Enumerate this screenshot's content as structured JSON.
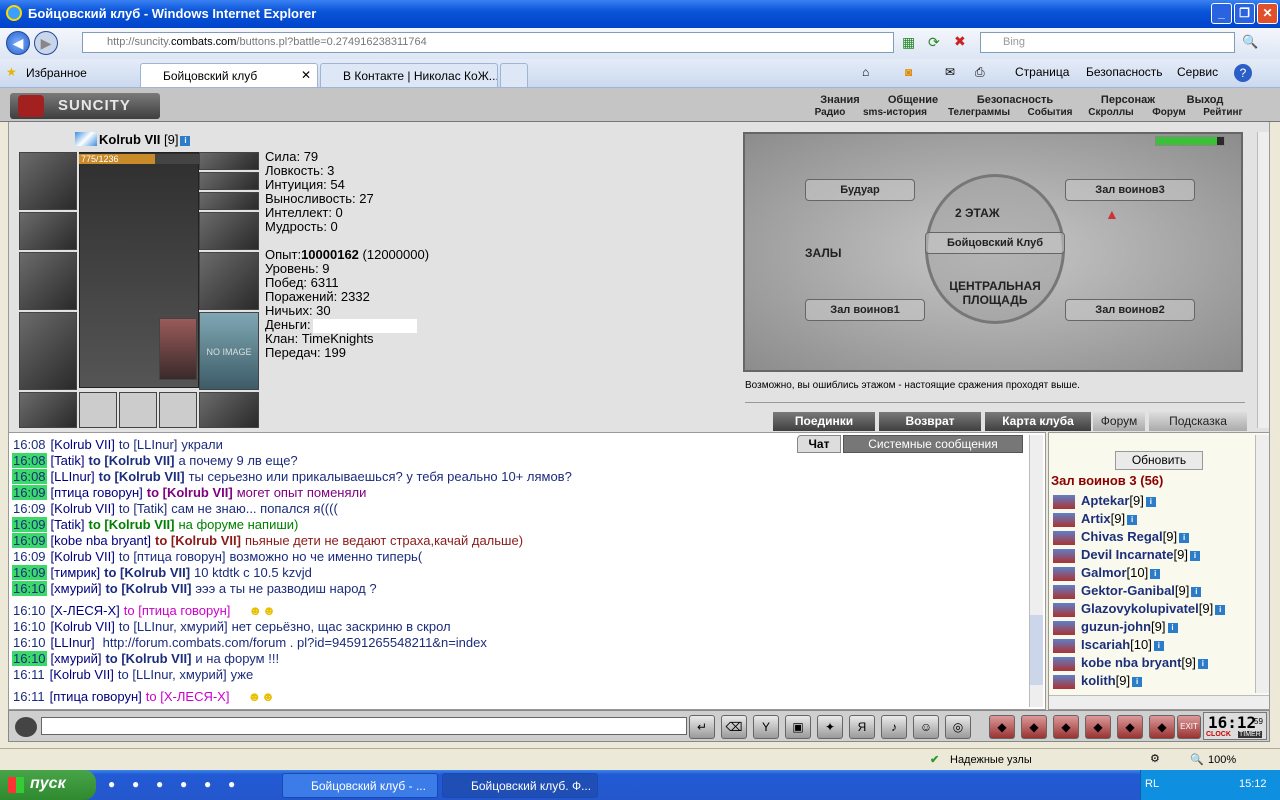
{
  "window": {
    "title": "Бойцовский клуб - Windows Internet Explorer"
  },
  "address": {
    "url_prefix": "http://suncity.",
    "url_domain": "combats.com",
    "url_path": "/buttons.pl?battle=0.274916238311764",
    "search_placeholder": "Bing"
  },
  "tabs": {
    "favorites": "Избранное",
    "tab1": "Бойцовский клуб",
    "tab2": "В Контакте | Николас КоЖ..."
  },
  "commands": {
    "page": "Страница",
    "safety": "Безопасность",
    "service": "Сервис"
  },
  "game_menu": {
    "top": [
      "Знания",
      "Общение",
      "Безопасность",
      "Персонаж",
      "Выход"
    ],
    "sub": [
      "Радио",
      "sms-история",
      "Телеграммы",
      "События",
      "Скроллы",
      "Форум",
      "Рейтинг"
    ],
    "logo": "SUNCITY"
  },
  "character": {
    "name": "Kolrub VII",
    "level": "[9]",
    "hp": "775/1236",
    "noimage": "NO IMAGE",
    "stats": [
      "Сила: 79",
      "Ловкость: 3",
      "Интуиция: 54",
      "Выносливость: 27",
      "Интеллект: 0",
      "Мудрость: 0"
    ],
    "exp_label": "Опыт:",
    "exp_value": "10000162",
    "exp_next": "(12000000)",
    "info": [
      "Уровень: 9",
      "Побед: 6311",
      "Поражений: 2332",
      "Ничьих: 30"
    ],
    "money_label": "Деньги:",
    "clan": "Клан: TimeKnights",
    "transfers": "Передач: 199"
  },
  "map": {
    "boudoir": "Будуар",
    "hall3": "Зал воинов3",
    "floor": "2 ЭТАЖ",
    "club": "Бойцовский Клуб",
    "halls": "ЗАЛЫ",
    "central": "ЦЕНТРАЛЬНАЯ ПЛОЩАДЬ",
    "hall1": "Зал воинов1",
    "hall2": "Зал воинов2",
    "note": "Возможно, вы ошиблись этажом - настоящие сражения проходят выше."
  },
  "panel_buttons": [
    "Поединки",
    "Возврат",
    "Карта клуба",
    "Форум",
    "Подсказка"
  ],
  "chat_tabs": {
    "chat": "Чат",
    "system": "Системные сообщения"
  },
  "chat": [
    {
      "time": "16:08",
      "hl": false,
      "from": "[Kolrub VII]",
      "to": "to [LLInur]",
      "msg": "украли",
      "color": "#1c2c7c"
    },
    {
      "time": "16:08",
      "hl": true,
      "from": "[Tatik]",
      "to": "to [Kolrub VII]",
      "msg": "а почему 9 лв еще?",
      "color": "#1c2c7c"
    },
    {
      "time": "16:08",
      "hl": true,
      "from": "[LLInur]",
      "to": "to [Kolrub VII]",
      "msg": "ты серьезно или прикалываешься? у тебя реально 10+ лямов?",
      "color": "#1c2c7c"
    },
    {
      "time": "16:09",
      "hl": true,
      "from": "[птица говорун]",
      "to": "to [Kolrub VII]",
      "msg": "могет опыт поменяли",
      "color": "#800080"
    },
    {
      "time": "16:09",
      "hl": false,
      "from": "[Kolrub VII]",
      "to": "to [Tatik]",
      "msg": "сам не знаю... попался я((((",
      "color": "#1c2c7c"
    },
    {
      "time": "16:09",
      "hl": true,
      "from": "[Tatik]",
      "to": "to [Kolrub VII]",
      "msg": "на форуме напиши)",
      "color": "#008000"
    },
    {
      "time": "16:09",
      "hl": true,
      "from": "[kobe nba bryant]",
      "to": "to [Kolrub VII]",
      "msg": "пьяные дети не ведают страха,качай дальше)",
      "color": "#8b1a1a"
    },
    {
      "time": "16:09",
      "hl": false,
      "from": "[Kolrub VII]",
      "to": "to [птица говорун]",
      "msg": "возможно но че именно типерь(",
      "color": "#1c2c7c"
    },
    {
      "time": "16:09",
      "hl": true,
      "from": "[тимрик]",
      "to": "to [Kolrub VII]",
      "msg": "10 ktdtk c 10.5 kzvjd",
      "color": "#1c2c7c"
    },
    {
      "time": "16:10",
      "hl": true,
      "from": "[хмурий]",
      "to": "to [Kolrub VII]",
      "msg": "эээ а ты не разводиш народ ?",
      "color": "#1c2c7c"
    },
    {
      "time": "16:10",
      "hl": false,
      "from": "[X-ЛЕСЯ-X]",
      "to": "to [птица говорун]",
      "msg": "",
      "color": "#cc00cc"
    },
    {
      "time": "16:10",
      "hl": false,
      "from": "[Kolrub VII]",
      "to": "to [LLInur, хмурий]",
      "msg": "нет серьёзно, щас заскриню в скрол",
      "color": "#1c2c7c"
    },
    {
      "time": "16:10",
      "hl": false,
      "from": "[LLInur]",
      "to": "",
      "msg": "http://forum.combats.com/forum . pl?id=94591265548211&n=index",
      "color": "#1c2c7c"
    },
    {
      "time": "16:10",
      "hl": true,
      "from": "[хмурий]",
      "to": "to [Kolrub VII]",
      "msg": "и на форум !!!",
      "color": "#1c2c7c"
    },
    {
      "time": "16:11",
      "hl": false,
      "from": "[Kolrub VII]",
      "to": "to [LLInur, хмурий]",
      "msg": "уже",
      "color": "#1c2c7c"
    },
    {
      "time": "16:11",
      "hl": false,
      "from": "[птица говорун]",
      "to": "to [X-ЛЕСЯ-X]",
      "msg": "",
      "color": "#cc00cc"
    }
  ],
  "users_panel": {
    "refresh": "Обновить",
    "room": "Зал воинов 3 (56)",
    "users": [
      {
        "name": "Aptekar",
        "lvl": "[9]"
      },
      {
        "name": "Artix",
        "lvl": "[9]"
      },
      {
        "name": "Chivas Regal",
        "lvl": "[9]"
      },
      {
        "name": "Devil Incarnate",
        "lvl": "[9]"
      },
      {
        "name": "Galmor",
        "lvl": "[10]"
      },
      {
        "name": "Gektor-Ganibal",
        "lvl": "[9]"
      },
      {
        "name": "Glazovykolupivatel",
        "lvl": "[9]"
      },
      {
        "name": "guzun-john",
        "lvl": "[9]"
      },
      {
        "name": "Iscariah",
        "lvl": "[10]"
      },
      {
        "name": "kobe nba bryant",
        "lvl": "[9]"
      },
      {
        "name": "kolith",
        "lvl": "[9]"
      }
    ]
  },
  "clock": {
    "time": "16:12",
    "sec": "59",
    "clock_label": "CLOCK",
    "timer_label": "TIMER",
    "exit_label": "EXIT"
  },
  "statusbar": {
    "zone": "Надежные узлы",
    "zoom": "100%"
  },
  "taskbar": {
    "start": "пуск",
    "task1": "Бойцовский клуб - ...",
    "task2": "Бойцовский клуб. Ф...",
    "lang": "RL",
    "time": "15:12"
  },
  "colors": {
    "accent": "#0a54d8",
    "chat_highlight": "#3bd96a"
  }
}
